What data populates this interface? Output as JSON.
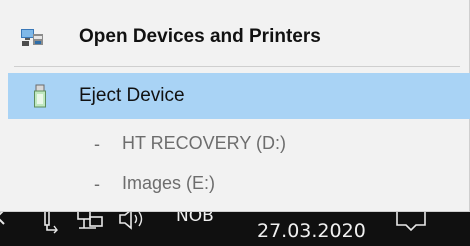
{
  "context_menu": {
    "open_devices": {
      "label": "Open Devices and Printers",
      "icon": "devices-printers-icon"
    },
    "eject_device": {
      "label": "Eject Device",
      "icon": "usb-drive-icon"
    },
    "drives": [
      {
        "dash": "-",
        "label": "HT RECOVERY (D:)"
      },
      {
        "dash": "-",
        "label": "Images (E:)"
      }
    ]
  },
  "taskbar": {
    "language": "NOB",
    "date": "27.03.2020"
  },
  "colors": {
    "menu_background": "#f2f2f2",
    "highlight": "#a9d3f5",
    "disabled_text": "#6d6d6d",
    "taskbar": "#101010"
  }
}
